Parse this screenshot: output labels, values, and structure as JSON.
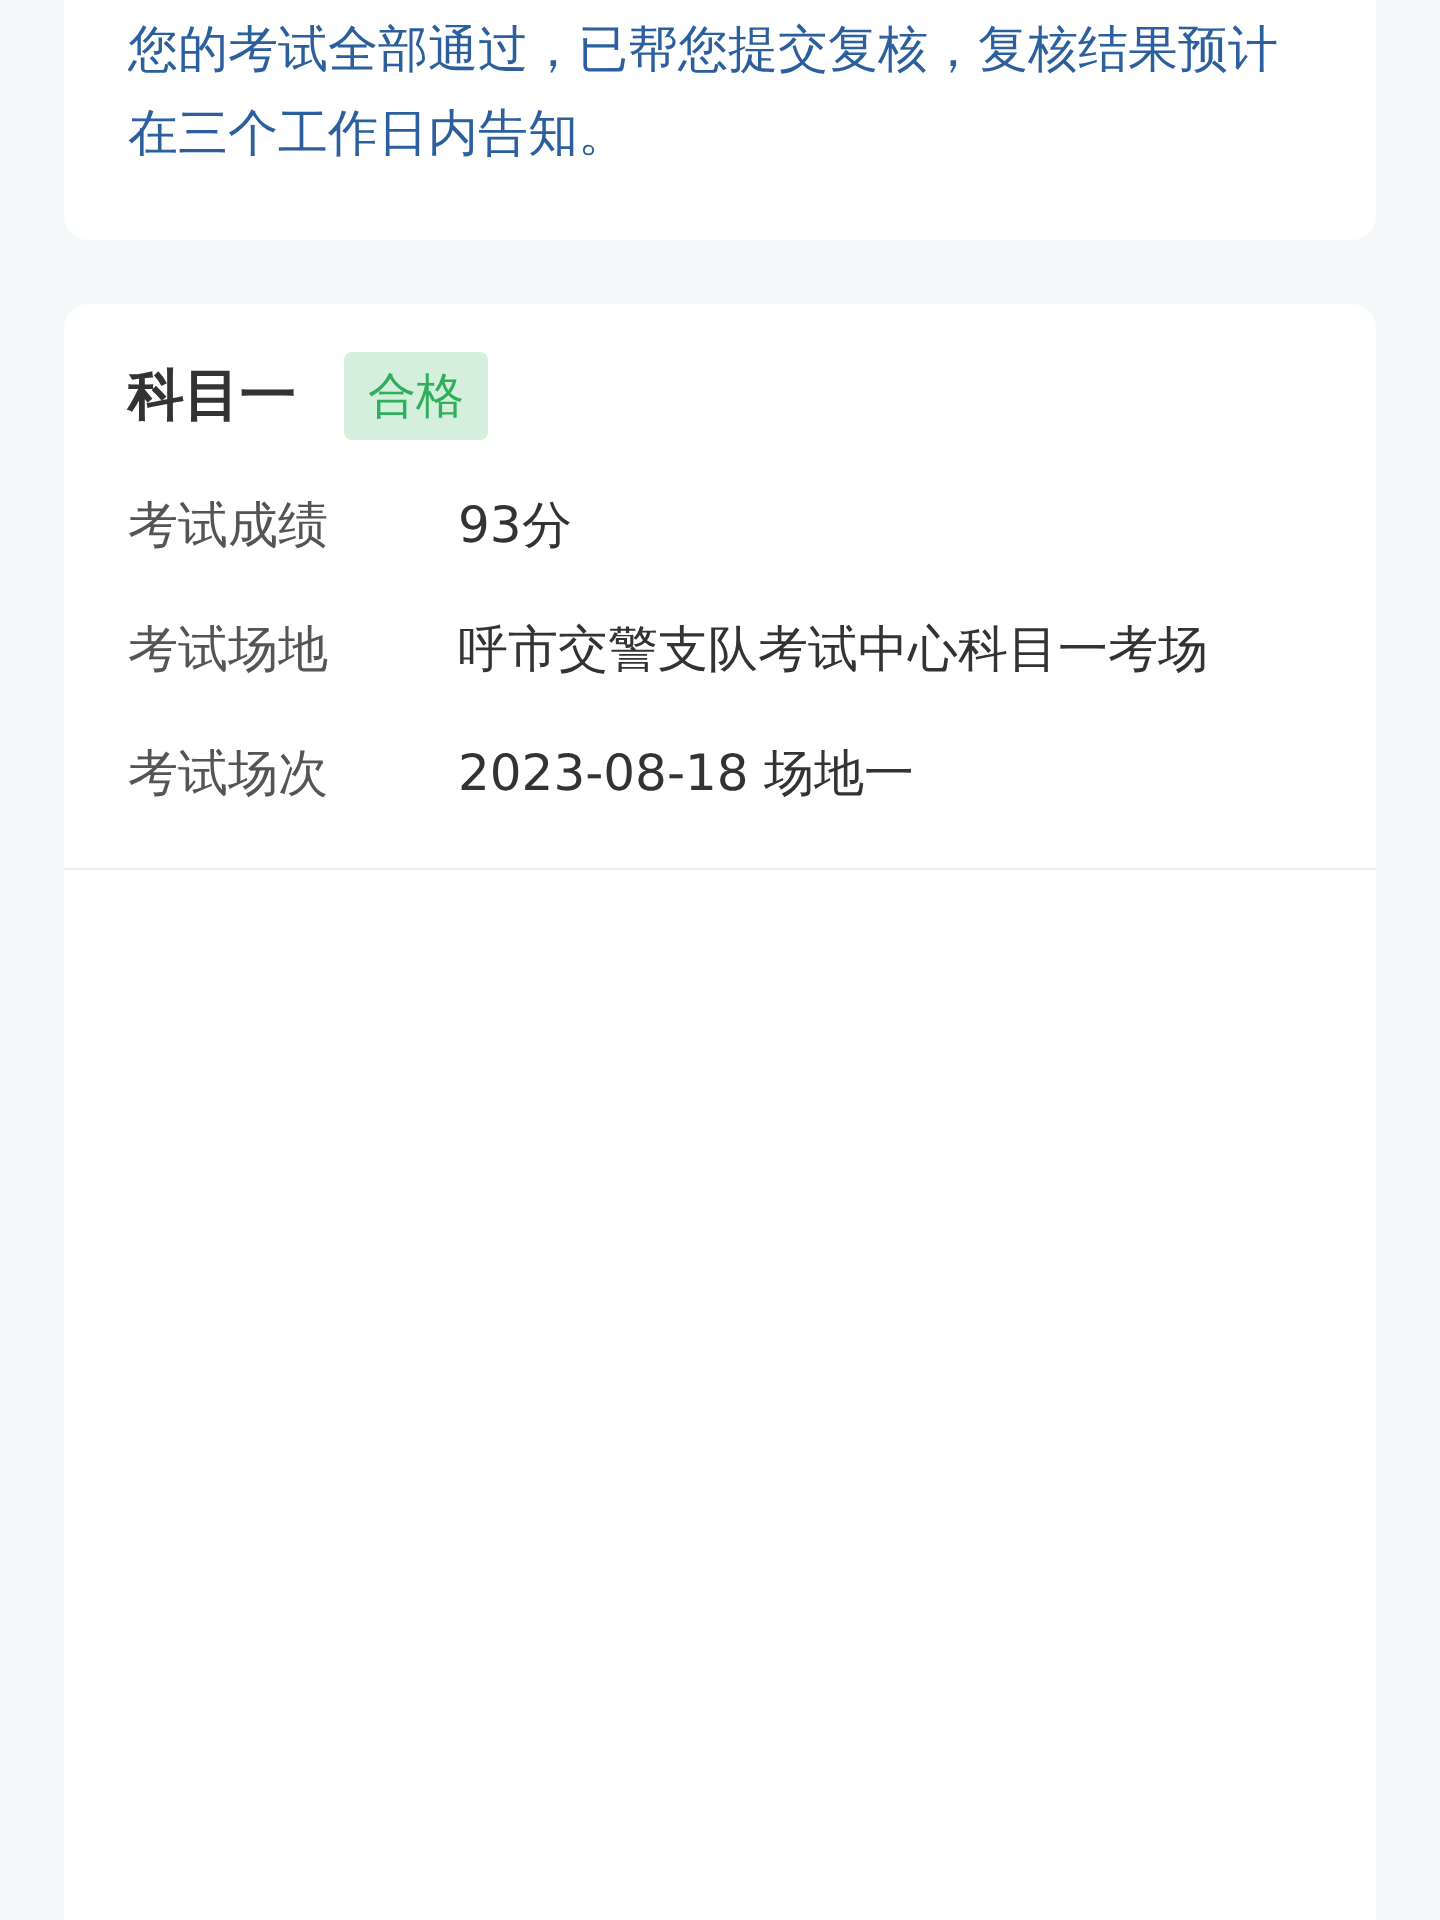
{
  "notice": {
    "text": "您的考试全部通过，已帮您提交复核，复核结果预计在三个工作日内告知。"
  },
  "subject": {
    "title": "科目一",
    "status": {
      "text": "合格",
      "kind": "pass"
    },
    "rows": [
      {
        "label": "考试成绩",
        "value": "93分"
      },
      {
        "label": "考试场地",
        "value": "呼市交警支队考试中心科目一考场"
      },
      {
        "label": "考试场次",
        "value": "2023-08-18 场地一"
      }
    ]
  }
}
